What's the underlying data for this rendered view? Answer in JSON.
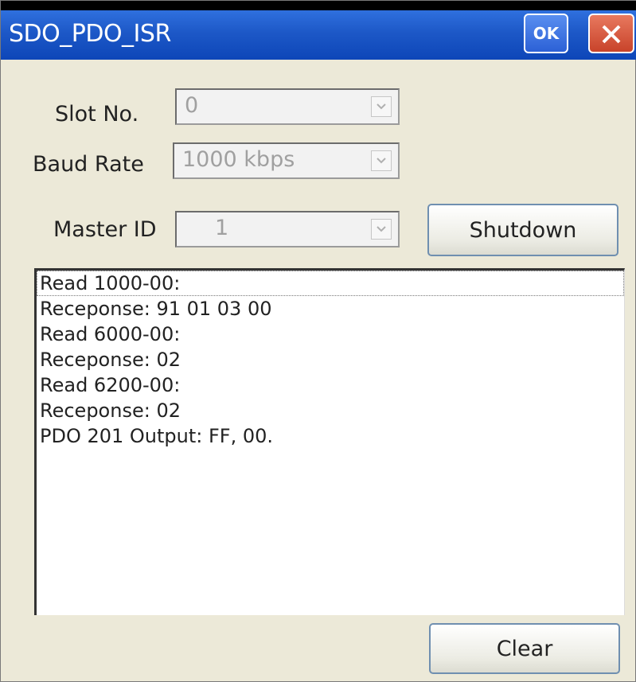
{
  "window": {
    "title": "SDO_PDO_ISR",
    "ok_label": "OK"
  },
  "form": {
    "slot_label": "Slot No.",
    "slot_value": "0",
    "baud_label": "Baud Rate",
    "baud_value": "1000 kbps",
    "master_label": "Master ID",
    "master_value": "1"
  },
  "buttons": {
    "shutdown": "Shutdown",
    "clear": "Clear"
  },
  "log": [
    "Read 1000-00:",
    "Receponse: 91 01 03 00",
    "Read 6000-00:",
    "Receponse: 02",
    "Read 6200-00:",
    "Receponse: 02",
    "PDO 201 Output: FF, 00."
  ]
}
